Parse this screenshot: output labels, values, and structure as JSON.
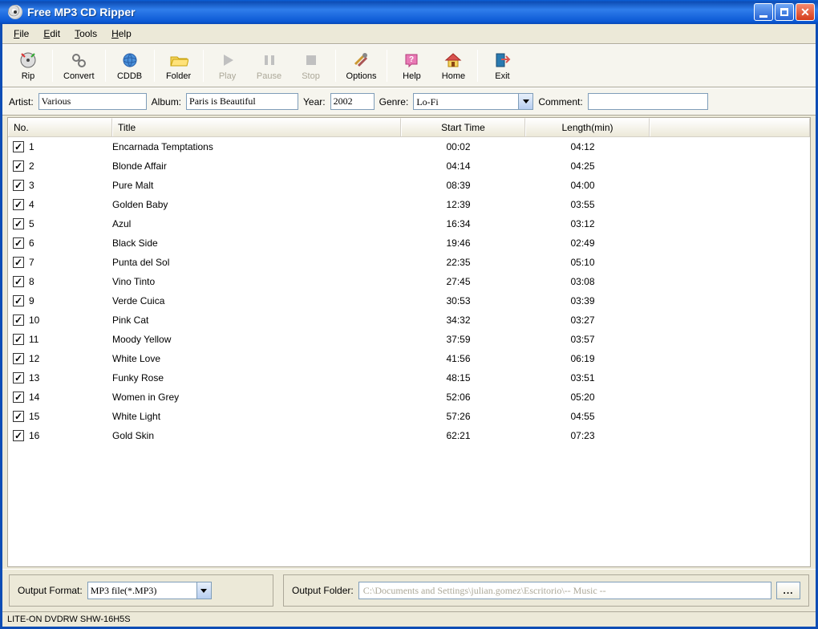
{
  "title": "Free MP3 CD Ripper",
  "menu": {
    "file": "File",
    "edit": "Edit",
    "tools": "Tools",
    "help": "Help"
  },
  "toolbar": {
    "rip": "Rip",
    "convert": "Convert",
    "cddb": "CDDB",
    "folder": "Folder",
    "play": "Play",
    "pause": "Pause",
    "stop": "Stop",
    "options": "Options",
    "help": "Help",
    "home": "Home",
    "exit": "Exit"
  },
  "info": {
    "artist_label": "Artist:",
    "artist": "Various",
    "album_label": "Album:",
    "album": "Paris is Beautiful",
    "year_label": "Year:",
    "year": "2002",
    "genre_label": "Genre:",
    "genre": "Lo-Fi",
    "comment_label": "Comment:",
    "comment": ""
  },
  "columns": {
    "no": "No.",
    "title": "Title",
    "start": "Start Time",
    "len": "Length(min)"
  },
  "tracks": [
    {
      "no": "1",
      "title": "Encarnada Temptations",
      "start": "00:02",
      "len": "04:12"
    },
    {
      "no": "2",
      "title": "Blonde Affair",
      "start": "04:14",
      "len": "04:25"
    },
    {
      "no": "3",
      "title": "Pure Malt",
      "start": "08:39",
      "len": "04:00"
    },
    {
      "no": "4",
      "title": "Golden Baby",
      "start": "12:39",
      "len": "03:55"
    },
    {
      "no": "5",
      "title": "Azul",
      "start": "16:34",
      "len": "03:12"
    },
    {
      "no": "6",
      "title": "Black Side",
      "start": "19:46",
      "len": "02:49"
    },
    {
      "no": "7",
      "title": "Punta del Sol",
      "start": "22:35",
      "len": "05:10"
    },
    {
      "no": "8",
      "title": "Vino Tinto",
      "start": "27:45",
      "len": "03:08"
    },
    {
      "no": "9",
      "title": "Verde Cuica",
      "start": "30:53",
      "len": "03:39"
    },
    {
      "no": "10",
      "title": "Pink Cat",
      "start": "34:32",
      "len": "03:27"
    },
    {
      "no": "11",
      "title": "Moody Yellow",
      "start": "37:59",
      "len": "03:57"
    },
    {
      "no": "12",
      "title": "White Love",
      "start": "41:56",
      "len": "06:19"
    },
    {
      "no": "13",
      "title": "Funky Rose",
      "start": "48:15",
      "len": "03:51"
    },
    {
      "no": "14",
      "title": "Women in Grey",
      "start": "52:06",
      "len": "05:20"
    },
    {
      "no": "15",
      "title": "White Light",
      "start": "57:26",
      "len": "04:55"
    },
    {
      "no": "16",
      "title": "Gold Skin",
      "start": "62:21",
      "len": "07:23"
    }
  ],
  "output": {
    "format_label": "Output Format:",
    "format": "MP3 file(*.MP3)",
    "folder_label": "Output Folder:",
    "folder": "C:\\Documents and Settings\\julian.gomez\\Escritorio\\-- Music --",
    "browse": "..."
  },
  "status": "LITE-ON DVDRW SHW-16H5S"
}
